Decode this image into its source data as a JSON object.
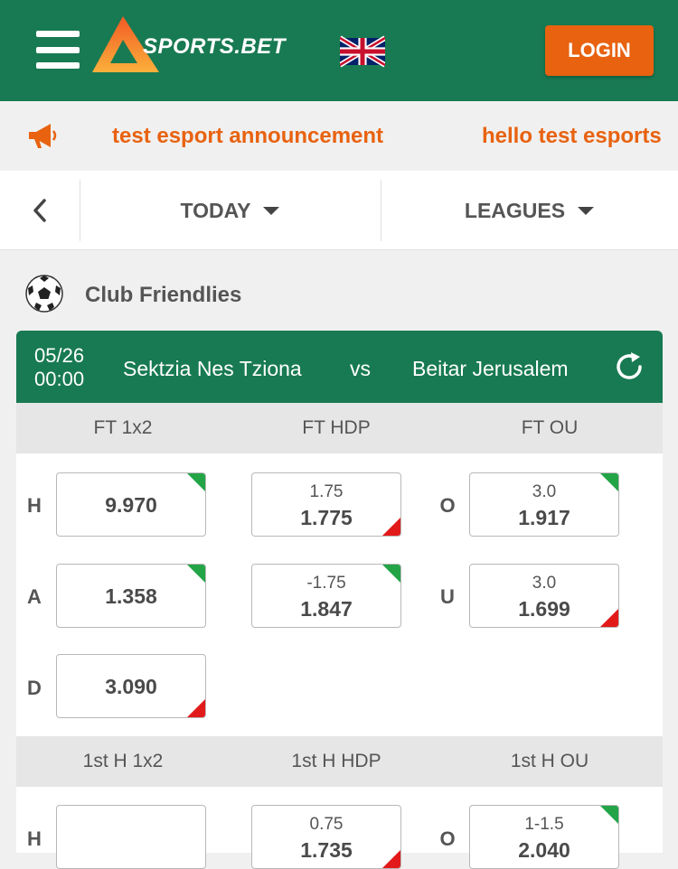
{
  "header": {
    "brand": "SPORTS.BET",
    "login_label": "LOGIN"
  },
  "announcements": [
    "test esport announcement",
    "hello test esports"
  ],
  "filters": {
    "day_label": "TODAY",
    "leagues_label": "LEAGUES"
  },
  "league": {
    "name": "Club Friendlies"
  },
  "match": {
    "date": "05/26",
    "time": "00:00",
    "home": "Sektzia Nes Tziona",
    "vs": "vs",
    "away": "Beitar Jerusalem"
  },
  "ft_markets": {
    "headers": [
      "FT 1x2",
      "FT HDP",
      "FT OU"
    ],
    "x12": [
      {
        "side": "H",
        "value": "9.970",
        "trend": "up"
      },
      {
        "side": "A",
        "value": "1.358",
        "trend": "up"
      },
      {
        "side": "D",
        "value": "3.090",
        "trend": "down"
      }
    ],
    "hdp": [
      {
        "line": "1.75",
        "value": "1.775",
        "trend": "down"
      },
      {
        "line": "-1.75",
        "value": "1.847",
        "trend": "up"
      }
    ],
    "ou": [
      {
        "side": "O",
        "line": "3.0",
        "value": "1.917",
        "trend": "up"
      },
      {
        "side": "U",
        "line": "3.0",
        "value": "1.699",
        "trend": "down"
      }
    ]
  },
  "h1_markets": {
    "headers": [
      "1st H 1x2",
      "1st H HDP",
      "1st H OU"
    ],
    "x12": [
      {
        "side": "H",
        "value": ""
      }
    ],
    "hdp": [
      {
        "line": "0.75",
        "value": "1.735",
        "trend": "down"
      }
    ],
    "ou": [
      {
        "side": "O",
        "line": "1-1.5",
        "value": "2.040",
        "trend": "up"
      }
    ]
  },
  "colors": {
    "brand_green": "#187a52",
    "accent_orange": "#e8620f",
    "odds_up": "#22a447",
    "odds_down": "#e21a1a"
  }
}
